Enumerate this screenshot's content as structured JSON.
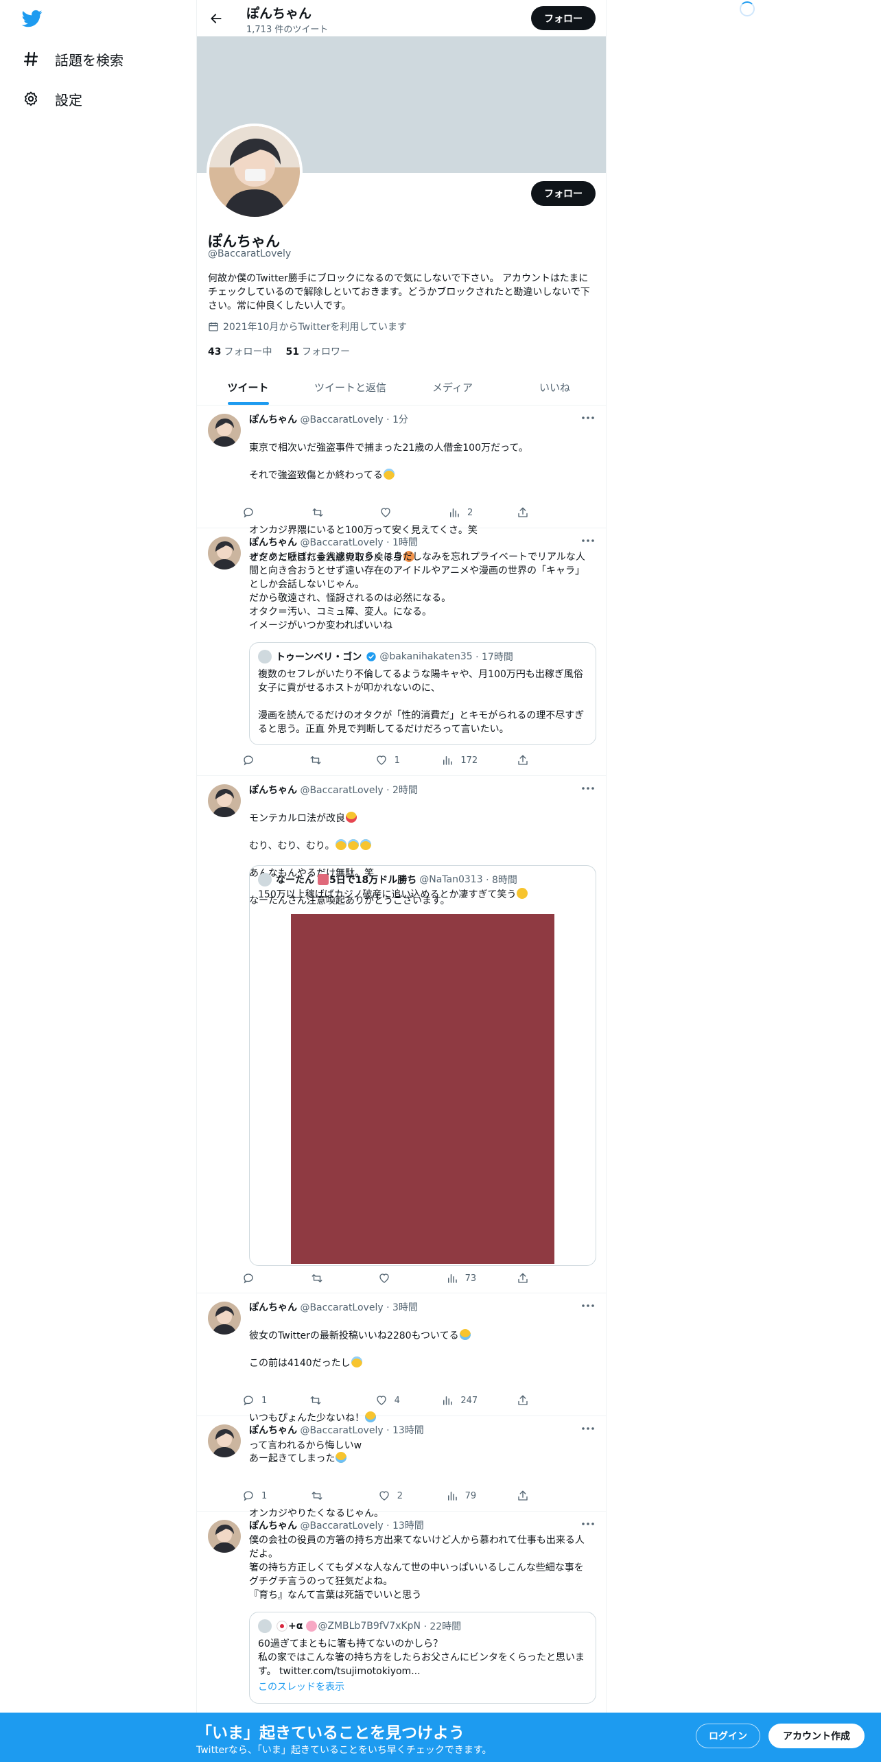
{
  "nav": {
    "explore_label": "話題を検索",
    "settings_label": "設定",
    "explore_icon": "hashtag-icon",
    "settings_icon": "gear-icon"
  },
  "header": {
    "name": "ぽんちゃん",
    "tweet_count": "1,713 件のツイート",
    "follow_label": "フォロー"
  },
  "profile": {
    "name": "ぽんちゃん",
    "handle": "@BaccaratLovely",
    "bio": "何故か僕のTwitter勝手にブロックになるので気にしないで下さい。 アカウントはたまにチェックしているので解除しといておきます。どうかブロックされたと勘違いしないで下さい。常に仲良くしたい人です。",
    "joined": "2021年10月からTwitterを利用しています",
    "following_count": "43",
    "following_label": "フォロー中",
    "followers_count": "51",
    "followers_label": "フォロワー",
    "follow_label": "フォロー"
  },
  "tabs": [
    {
      "label": "ツイート"
    },
    {
      "label": "ツイートと返信"
    },
    {
      "label": "メディア"
    },
    {
      "label": "いいね"
    }
  ],
  "tweets": [
    {
      "name": "ぽんちゃん",
      "handle": "@BaccaratLovely",
      "time": "· 1分",
      "lines": [
        "東京で相次いだ強盗事件で捕まった21歳の人借金100万だって。",
        "それで強盗致傷とか終わってる",
        "",
        "オンカジ界隈にいると100万って安く見えてくさ。笑",
        "ぜだめだ駄目だ金銭感覚取り戻そう"
      ],
      "replies": "",
      "retweets": "",
      "likes": "",
      "views": "2"
    },
    {
      "name": "ぽんちゃん",
      "handle": "@BaccaratLovely",
      "time": "· 1時間",
      "text": "オタクと呼ばれる人達のお多くは身だしなみを忘れプライベートでリアルな人間と向き合おうとせず遠い存在のアイドルやアニメや漫画の世界の「キャラ」としか会話しないじゃん。\nだから敬遠され、怪訝されるのは必然になる。\nオタク＝汚い、コミュ障、変人。になる。\nイメージがいつか変わればいいね",
      "quote": {
        "name": "トゥーンベリ・ゴン",
        "handle": "@bakanihakaten35",
        "time": "· 17時間",
        "text": "複数のセフレがいたり不倫してるような陽キャや、月100万円も出稼ぎ風俗女子に貢がせるホストが叩かれないのに、\n\n漫画を読んでるだけのオタクが「性的消費だ」とキモがられるの理不尽すぎると思う。正直 外見で判断してるだけだろって言いたい。"
      },
      "replies": "",
      "retweets": "",
      "likes": "1",
      "views": "172"
    },
    {
      "name": "ぽんちゃん",
      "handle": "@BaccaratLovely",
      "time": "· 2時間",
      "lines": [
        "モンテカルロ法が改良",
        "むり、むり、むり。",
        "あんなもんやるだけ無駄。笑",
        "なーたんさん注意喚起ありがとうございます。"
      ],
      "quote": {
        "name": "なーたん",
        "name_suffix": "5日で18万ドル勝ち",
        "handle": "@NaTan0313",
        "time": "· 8時間",
        "text": "150万以上稼げばカジノ破産に追い込めるとか凄すぎて笑う"
      },
      "replies": "",
      "retweets": "",
      "likes": "",
      "views": "73"
    },
    {
      "name": "ぽんちゃん",
      "handle": "@BaccaratLovely",
      "time": "· 3時間",
      "lines": [
        "彼女のTwitterの最新投稿いいね2280もついてる",
        "この前は4140だったし",
        "",
        "いつもぴょんた少ないね！",
        "って言われるから悔しいw"
      ],
      "replies": "1",
      "retweets": "",
      "likes": "4",
      "views": "247"
    },
    {
      "name": "ぽんちゃん",
      "handle": "@BaccaratLovely",
      "time": "· 13時間",
      "lines": [
        "あー起きてしまった",
        "",
        "オンカジやりたくなるじゃん。"
      ],
      "replies": "1",
      "retweets": "",
      "likes": "2",
      "views": "79"
    },
    {
      "name": "ぽんちゃん",
      "handle": "@BaccaratLovely",
      "time": "· 13時間",
      "text": "僕の会社の役員の方箸の持ち方出来てないけど人から慕われて仕事も出来る人だよ。\n箸の持ち方正しくてもダメな人なんて世の中いっぱいいるしこんな些細な事をグチグチ言うのって狂気だよね。\n『育ち』なんて言葉は死語でいいと思う",
      "quote": {
        "name": "+α",
        "handle": "@ZMBLb7B9fV7xKpN",
        "time": "· 22時間",
        "text": "60過ぎてまともに箸も持てないのかしら？\n私の家ではこんな箸の持ち方をしたらお父さんにビンタをくらったと思います。 twitter.com/tsujimotokiyom...",
        "link": "このスレッドを表示"
      },
      "replies": "",
      "retweets": "",
      "likes": "",
      "views": ""
    }
  ],
  "bottom": {
    "title": "「いま」起きていることを見つけよう",
    "subtitle": "Twitterなら、「いま」起きていることをいち早くチェックできます。",
    "login_label": "ログイン",
    "signup_label": "アカウント作成"
  },
  "colors": {
    "accent": "#1d9bf0",
    "banner": "#cfd9de",
    "text": "#0f1419",
    "muted": "#536471"
  }
}
